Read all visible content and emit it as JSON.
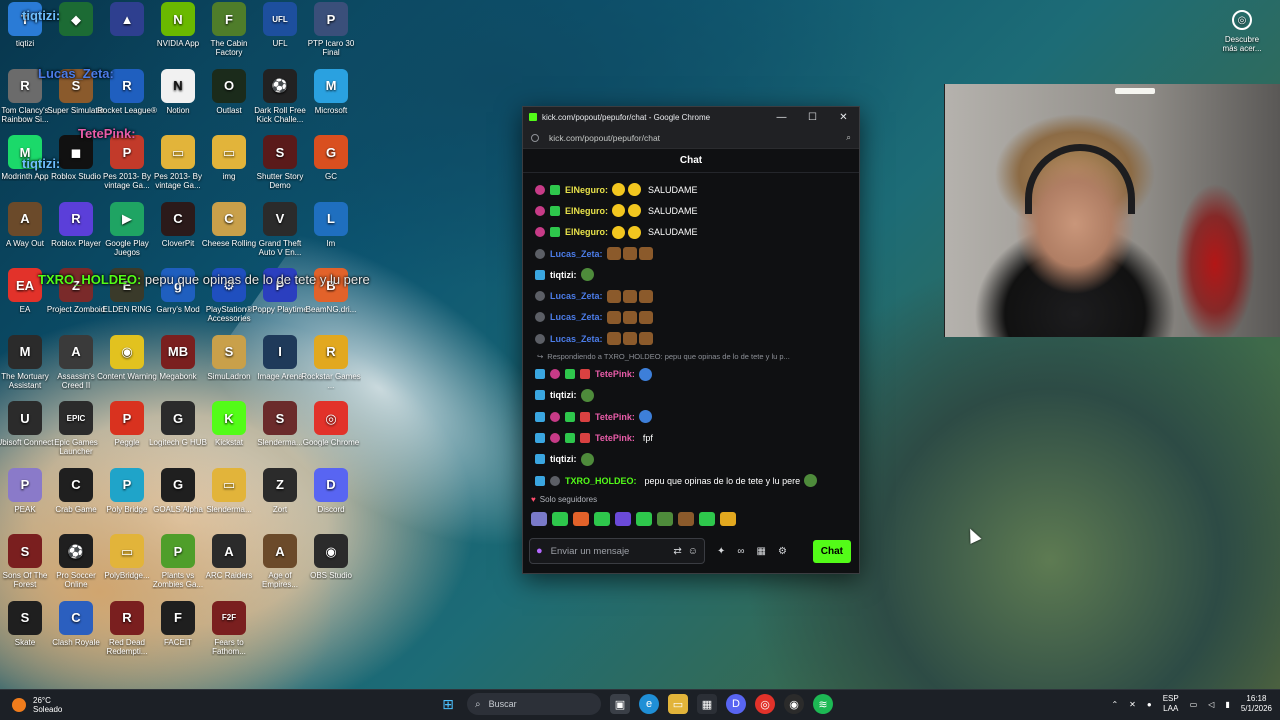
{
  "desktop": {
    "icons": [
      {
        "label": "tiqtizi",
        "color": "#2a7bd6",
        "glyph": "T"
      },
      {
        "label": "",
        "color": "#1c6b34",
        "glyph": "◆"
      },
      {
        "label": "",
        "color": "#2e3f8f",
        "glyph": "▲"
      },
      {
        "label": "NVIDIA App",
        "color": "#6ab900",
        "glyph": "N"
      },
      {
        "label": "The Cabin Factory",
        "color": "#4f7d2a",
        "glyph": "F"
      },
      {
        "label": "UFL",
        "color": "#1d4f9e",
        "glyph": "UFL"
      },
      {
        "label": "PTP Icaro 30 Final",
        "color": "#3a4f7a",
        "glyph": "P"
      },
      {
        "label": "Tom Clancy's Rainbow Si...",
        "color": "#6b6b6b",
        "glyph": "R"
      },
      {
        "label": "Super Simulator",
        "color": "#8a5a2c",
        "glyph": "S"
      },
      {
        "label": "Rocket League®",
        "color": "#1f5fbf",
        "glyph": "R"
      },
      {
        "label": "Notion",
        "color": "#f1f1f1",
        "glyph": "N"
      },
      {
        "label": "Outlast",
        "color": "#1b2b1b",
        "glyph": "O"
      },
      {
        "label": "Dark Roll Free Kick Challe...",
        "color": "#222222",
        "glyph": "⚽"
      },
      {
        "label": "Microsoft",
        "color": "#2aa1e0",
        "glyph": "M"
      },
      {
        "label": "Modrinth App",
        "color": "#1bd96a",
        "glyph": "M"
      },
      {
        "label": "Roblox Studio",
        "color": "#111111",
        "glyph": "◼"
      },
      {
        "label": "Pes 2013- By vintage Ga...",
        "color": "#c23a2a",
        "glyph": "P"
      },
      {
        "label": "Pes 2013- By vintage Ga...",
        "color": "#e2b43a",
        "glyph": "▭"
      },
      {
        "label": "img",
        "color": "#e2b43a",
        "glyph": "▭"
      },
      {
        "label": "Shutter Story Demo",
        "color": "#5a1a1a",
        "glyph": "S"
      },
      {
        "label": "GC",
        "color": "#d94f1f",
        "glyph": "G"
      },
      {
        "label": "A Way Out",
        "color": "#6b4a2a",
        "glyph": "A"
      },
      {
        "label": "Roblox Player",
        "color": "#5b3fd9",
        "glyph": "R"
      },
      {
        "label": "Google Play Juegos",
        "color": "#1fa463",
        "glyph": "▶"
      },
      {
        "label": "CloverPit",
        "color": "#2b1a1a",
        "glyph": "C"
      },
      {
        "label": "Cheese Rolling",
        "color": "#c9a04a",
        "glyph": "C"
      },
      {
        "label": "Grand Theft Auto V En...",
        "color": "#2b2b2b",
        "glyph": "V"
      },
      {
        "label": "lm",
        "color": "#1f6fbf",
        "glyph": "L"
      },
      {
        "label": "EA",
        "color": "#e2322a",
        "glyph": "EA"
      },
      {
        "label": "Project Zomboid",
        "color": "#7a2a2a",
        "glyph": "Z"
      },
      {
        "label": "ELDEN RING",
        "color": "#3a3a2a",
        "glyph": "E"
      },
      {
        "label": "Garry's Mod",
        "color": "#1f5fbf",
        "glyph": "g"
      },
      {
        "label": "PlayStation® Accessories",
        "color": "#1f4fbf",
        "glyph": "⚙"
      },
      {
        "label": "Poppy Playtime",
        "color": "#2b3fbf",
        "glyph": "P"
      },
      {
        "label": "BeamNG.dri...",
        "color": "#e2622a",
        "glyph": "B"
      },
      {
        "label": "The Mortuary Assistant",
        "color": "#2b2b2b",
        "glyph": "M"
      },
      {
        "label": "Assassin's Creed II",
        "color": "#3a3a3a",
        "glyph": "A"
      },
      {
        "label": "Content Warning",
        "color": "#e2c21f",
        "glyph": "◉"
      },
      {
        "label": "Megabonk",
        "color": "#7a1f1f",
        "glyph": "MB"
      },
      {
        "label": "SimuLadron",
        "color": "#c9a04a",
        "glyph": "S"
      },
      {
        "label": "Image Arena",
        "color": "#1f3a5a",
        "glyph": "I"
      },
      {
        "label": "Rockstar Games ...",
        "color": "#e2a81f",
        "glyph": "R"
      },
      {
        "label": "Ubisoft Connect",
        "color": "#2b2b2b",
        "glyph": "U"
      },
      {
        "label": "Epic Games Launcher",
        "color": "#2b2b2b",
        "glyph": "EPIC"
      },
      {
        "label": "Peggle",
        "color": "#d9321f",
        "glyph": "P"
      },
      {
        "label": "Logitech G HUB",
        "color": "#2b2b2b",
        "glyph": "G"
      },
      {
        "label": "Kickstat",
        "color": "#53fc18",
        "glyph": "K"
      },
      {
        "label": "Slendermа...",
        "color": "#6b2b2b",
        "glyph": "S"
      },
      {
        "label": "Google Chrome",
        "color": "#e2322a",
        "glyph": "◎"
      },
      {
        "label": "PEAK",
        "color": "#8a7ac9",
        "glyph": "P"
      },
      {
        "label": "Crab Game",
        "color": "#1f1f1f",
        "glyph": "C"
      },
      {
        "label": "Poly Bridge",
        "color": "#1fa4c9",
        "glyph": "P"
      },
      {
        "label": "GOALS Alpha",
        "color": "#1f1f1f",
        "glyph": "G"
      },
      {
        "label": "Slenderma...",
        "color": "#e2b43a",
        "glyph": "▭"
      },
      {
        "label": "Zort",
        "color": "#2b2b2b",
        "glyph": "Z"
      },
      {
        "label": "Discord",
        "color": "#5865f2",
        "glyph": "D"
      },
      {
        "label": "Sons Of The Forest",
        "color": "#7a1f1f",
        "glyph": "S"
      },
      {
        "label": "Pro Soccer Online",
        "color": "#1f1f1f",
        "glyph": "⚽"
      },
      {
        "label": "PolyBridge...",
        "color": "#e2b43a",
        "glyph": "▭"
      },
      {
        "label": "Plants vs Zombies Ga...",
        "color": "#4f9e2a",
        "glyph": "P"
      },
      {
        "label": "ARC Raiders",
        "color": "#2b2b2b",
        "glyph": "A"
      },
      {
        "label": "Age of Empires...",
        "color": "#6b4a2a",
        "glyph": "A"
      },
      {
        "label": "OBS Studio",
        "color": "#2b2b2b",
        "glyph": "◉"
      },
      {
        "label": "Skate",
        "color": "#1f1f1f",
        "glyph": "S"
      },
      {
        "label": "Clash Royale",
        "color": "#2b5fbf",
        "glyph": "C"
      },
      {
        "label": "Red Dead Redempti...",
        "color": "#7a1f1f",
        "glyph": "R"
      },
      {
        "label": "FACEIT",
        "color": "#1f1f1f",
        "glyph": "F"
      },
      {
        "label": "Fears to Fathom...",
        "color": "#7a1f1f",
        "glyph": "F2F"
      }
    ],
    "overlay": {
      "line1_user": "tiqtizi:",
      "line2_user": "Lucas_Zeta:",
      "line3_user": "TetePink:",
      "line4_user": "tiqtizi:",
      "highlight_user": "TXRO_HOLDEO:",
      "highlight_text": "pepu que opinas de lo de tete y lu pere"
    },
    "discover": {
      "label": "Descubre más acer..."
    }
  },
  "window": {
    "title": "kick.com/popout/pepufor/chat - Google Chrome",
    "url": "kick.com/popout/pepufor/chat",
    "minimize": "—",
    "maximize": "☐",
    "close": "✕",
    "zoom_icon": "⌕"
  },
  "chat": {
    "header": "Chat",
    "messages": [
      {
        "user": "ElNeguro:",
        "user_color": "#e8e24a",
        "badges": [
          "sub",
          "green"
        ],
        "emotes": [
          "yellow",
          "yellow"
        ],
        "text": "SALUDAME"
      },
      {
        "user": "ElNeguro:",
        "user_color": "#e8e24a",
        "badges": [
          "sub",
          "green"
        ],
        "emotes": [
          "yellow",
          "yellow"
        ],
        "text": "SALUDAME"
      },
      {
        "user": "ElNeguro:",
        "user_color": "#e8e24a",
        "badges": [
          "sub",
          "green"
        ],
        "emotes": [
          "yellow",
          "yellow"
        ],
        "text": "SALUDAME"
      },
      {
        "user": "Lucas_Zeta:",
        "user_color": "#4b7ce8",
        "badges": [
          "grey"
        ],
        "emotes": [
          "brown",
          "brown",
          "brown"
        ],
        "text": ""
      },
      {
        "user": "tiqtizi:",
        "user_color": "#ffffff",
        "badges": [
          "mod"
        ],
        "emotes": [
          "green"
        ],
        "text": ""
      },
      {
        "user": "Lucas_Zeta:",
        "user_color": "#4b7ce8",
        "badges": [
          "grey"
        ],
        "emotes": [
          "brown",
          "brown",
          "brown"
        ],
        "text": ""
      },
      {
        "user": "Lucas_Zeta:",
        "user_color": "#4b7ce8",
        "badges": [
          "grey"
        ],
        "emotes": [
          "brown",
          "brown",
          "brown"
        ],
        "text": ""
      },
      {
        "user": "Lucas_Zeta:",
        "user_color": "#4b7ce8",
        "badges": [
          "grey"
        ],
        "emotes": [
          "brown",
          "brown",
          "brown"
        ],
        "text": ""
      }
    ],
    "reply_note": "Respondiendo a TXRO_HOLDEO: pepu que opinas de lo de tete y lu p...",
    "messages2": [
      {
        "user": "TetePink:",
        "user_color": "#e85ca8",
        "badges": [
          "mod",
          "sub",
          "green",
          "red"
        ],
        "emotes": [
          "blue"
        ],
        "text": ""
      },
      {
        "user": "tiqtizi:",
        "user_color": "#ffffff",
        "badges": [
          "mod"
        ],
        "emotes": [
          "green"
        ],
        "text": ""
      },
      {
        "user": "TetePink:",
        "user_color": "#e85ca8",
        "badges": [
          "mod",
          "sub",
          "green",
          "red"
        ],
        "emotes": [
          "blue"
        ],
        "text": ""
      },
      {
        "user": "TetePink:",
        "user_color": "#e85ca8",
        "badges": [
          "mod",
          "sub",
          "green",
          "red"
        ],
        "emotes": [],
        "text": "fpf"
      },
      {
        "user": "tiqtizi:",
        "user_color": "#ffffff",
        "badges": [
          "mod"
        ],
        "emotes": [
          "green"
        ],
        "text": ""
      },
      {
        "user": "TXRO_HOLDEO:",
        "user_color": "#53fc18",
        "badges": [
          "mod",
          "grey"
        ],
        "emotes": [],
        "text": "pepu que opinas de lo de tete y lu pere",
        "trailing_emote": "green"
      }
    ],
    "followers_only": "Solo seguidores",
    "emote_bar_colors": [
      "#7a7ac9",
      "#2ec74c",
      "#e2622a",
      "#2ec74c",
      "#6b4ad9",
      "#2ec74c",
      "#4e8b3b",
      "#8b5a2b",
      "#2ec74c",
      "#e2a81f"
    ],
    "input_placeholder": "Enviar un mensaje",
    "send_label": "Chat",
    "accent": "#53fc18"
  },
  "taskbar": {
    "weather_temp": "26°C",
    "weather_desc": "Soleado",
    "search_label": "Buscar",
    "lang_top": "ESP",
    "lang_bottom": "LAA",
    "time": "16:18",
    "date": "5/1/2026"
  }
}
